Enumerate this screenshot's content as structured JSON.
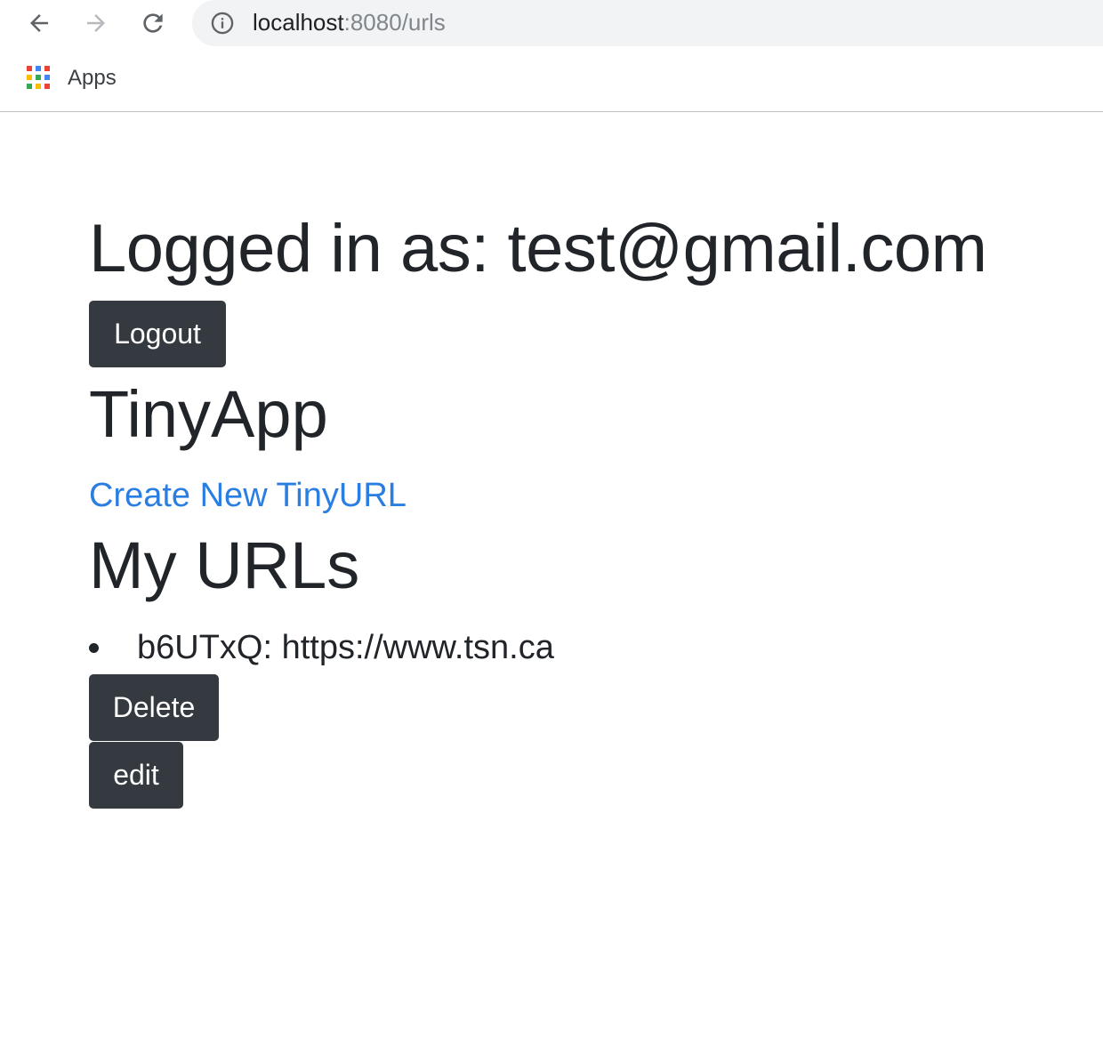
{
  "browser": {
    "back_icon": "arrow-left-icon",
    "forward_icon": "arrow-right-icon",
    "reload_icon": "reload-icon",
    "info_icon": "info-icon",
    "url_host": "localhost",
    "url_path": ":8080/urls",
    "bookmarks": {
      "apps_label": "Apps",
      "apps_icon": "apps-grid-icon",
      "apps_colors": [
        "#ea4335",
        "#4285f4",
        "#ea4335",
        "#fbbc05",
        "#34a853",
        "#4285f4",
        "#34a853",
        "#fbbc05",
        "#ea4335"
      ]
    }
  },
  "page": {
    "logged_in_text": "Logged in as: test@gmail.com",
    "logout_label": "Logout",
    "brand_title": "TinyApp",
    "create_link_label": "Create New TinyURL",
    "my_urls_heading": "My URLs",
    "urls": [
      {
        "text": "b6UTxQ: https://www.tsn.ca"
      }
    ],
    "delete_label": "Delete",
    "edit_label": "edit"
  },
  "colors": {
    "button_bg": "#343a40",
    "link": "#2a7de1",
    "text": "#212529"
  }
}
